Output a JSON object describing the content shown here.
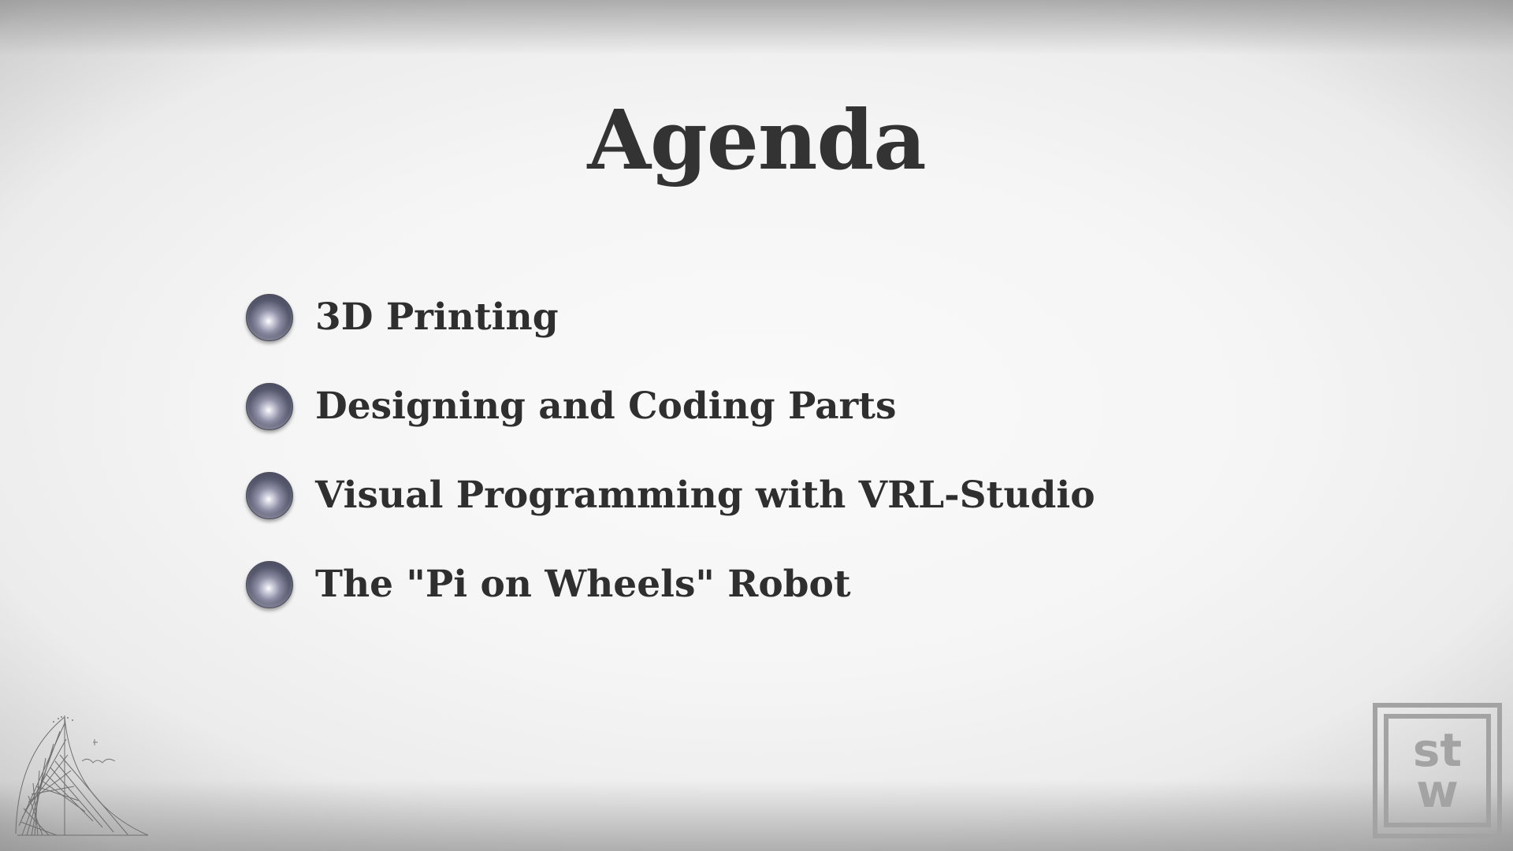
{
  "slide": {
    "title": "Agenda"
  },
  "agenda": {
    "items": [
      {
        "label": "3D Printing"
      },
      {
        "label": "Designing and Coding Parts"
      },
      {
        "label": "Visual Programming with VRL-Studio"
      },
      {
        "label": "The \"Pi on Wheels\" Robot"
      }
    ]
  },
  "logo": {
    "line1": "st",
    "line2": "w"
  },
  "colors": {
    "title_text": "#333333",
    "body_text": "#2f2f2f",
    "bullet": "#585a70",
    "logo_gray": "#a3a3a3"
  },
  "icons": {
    "bullet": "sphere-bullet-icon",
    "decoration": "curve-sketch-icon"
  }
}
